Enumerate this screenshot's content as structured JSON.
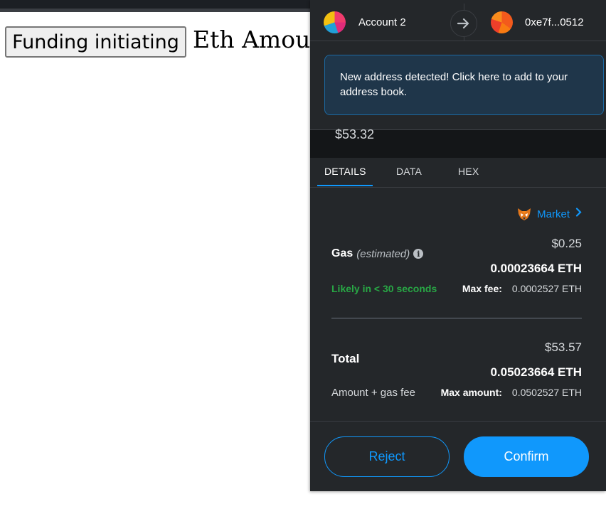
{
  "page": {
    "fund_button_label": "Funding initiating",
    "eth_amount_label": "Eth Amount"
  },
  "header": {
    "from_account": "Account 2",
    "to_address": "0xe7f...0512"
  },
  "notice": {
    "text": "New address detected! Click here to add to your address book."
  },
  "value": {
    "fiat": "$53.32"
  },
  "tabs": [
    {
      "label": "DETAILS",
      "active": true
    },
    {
      "label": "DATA",
      "active": false
    },
    {
      "label": "HEX",
      "active": false
    }
  ],
  "market": {
    "label": "Market"
  },
  "gas": {
    "title": "Gas",
    "estimated": "(estimated)",
    "fiat": "$0.25",
    "eth": "0.00023664 ETH",
    "likely": "Likely in < 30 seconds",
    "max_fee_label": "Max fee:",
    "max_fee_value": "0.0002527 ETH"
  },
  "total": {
    "title": "Total",
    "fiat": "$53.57",
    "eth": "0.05023664 ETH",
    "amount_gas_label": "Amount + gas fee",
    "max_amount_label": "Max amount:",
    "max_amount_value": "0.0502527 ETH"
  },
  "actions": {
    "reject_label": "Reject",
    "confirm_label": "Confirm"
  },
  "colors": {
    "accent": "#1098fc",
    "success": "#28a745",
    "panel": "#24272a"
  }
}
